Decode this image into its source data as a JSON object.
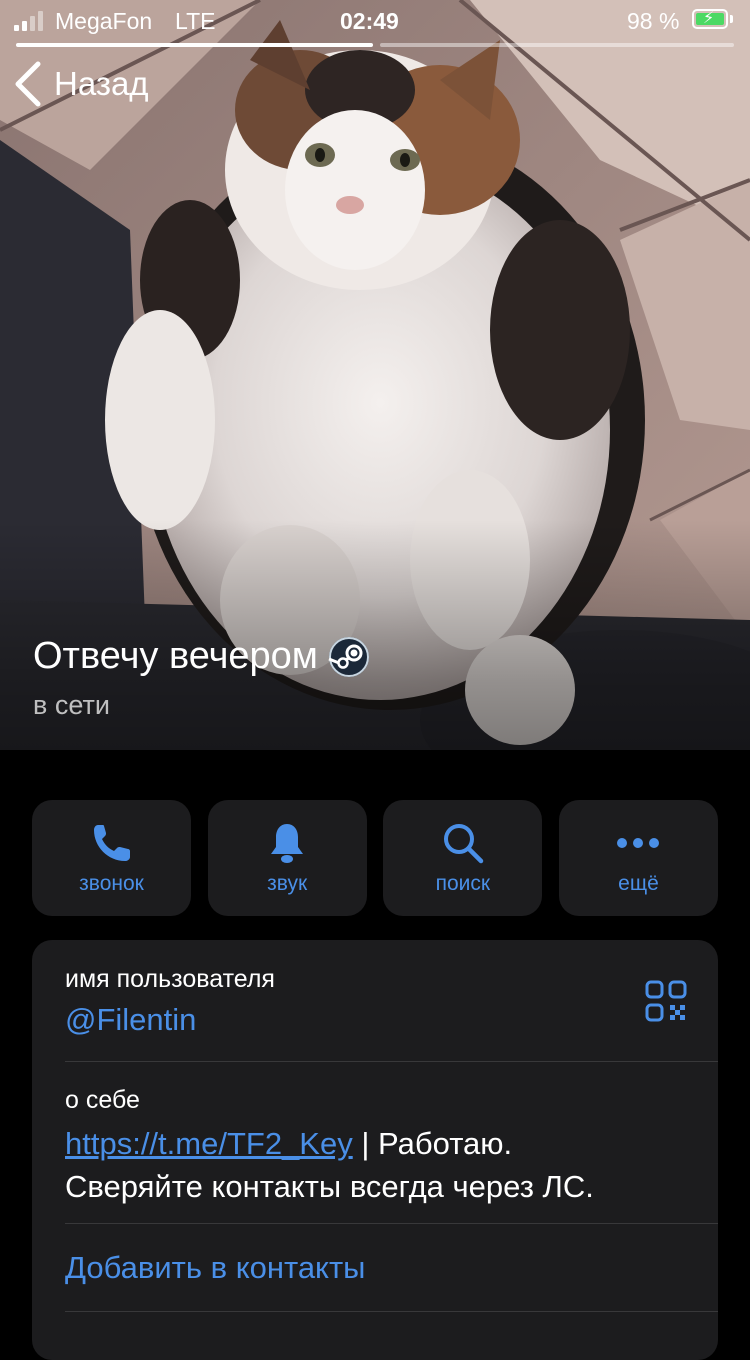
{
  "status_bar": {
    "carrier": "MegaFon",
    "network": "LTE",
    "time": "02:49",
    "battery_percent": "98 %",
    "signal_bars_filled": 2,
    "signal_bars_total": 4,
    "story_progress": [
      1,
      0
    ]
  },
  "nav": {
    "back_label": "Назад"
  },
  "profile": {
    "name": "Отвечу вечером",
    "status": "в сети",
    "emoji_icon": "steam-logo-icon"
  },
  "actions": [
    {
      "label": "звонок",
      "icon": "phone-icon"
    },
    {
      "label": "звук",
      "icon": "bell-icon"
    },
    {
      "label": "поиск",
      "icon": "search-icon"
    },
    {
      "label": "ещё",
      "icon": "more-dots-icon"
    }
  ],
  "info": {
    "username_label": "имя пользователя",
    "username": "@Filentin",
    "bio_label": "о себе",
    "bio_link": "https://t.me/TF2_Key",
    "bio_line1_rest": " | Работаю.",
    "bio_line2": "Сверяйте контакты всегда через ЛС.",
    "add_contact": "Добавить в контакты"
  },
  "colors": {
    "accent": "#4a8fe7",
    "background": "#000000",
    "card": "#1c1c1e",
    "battery_fill": "#4cd964"
  }
}
